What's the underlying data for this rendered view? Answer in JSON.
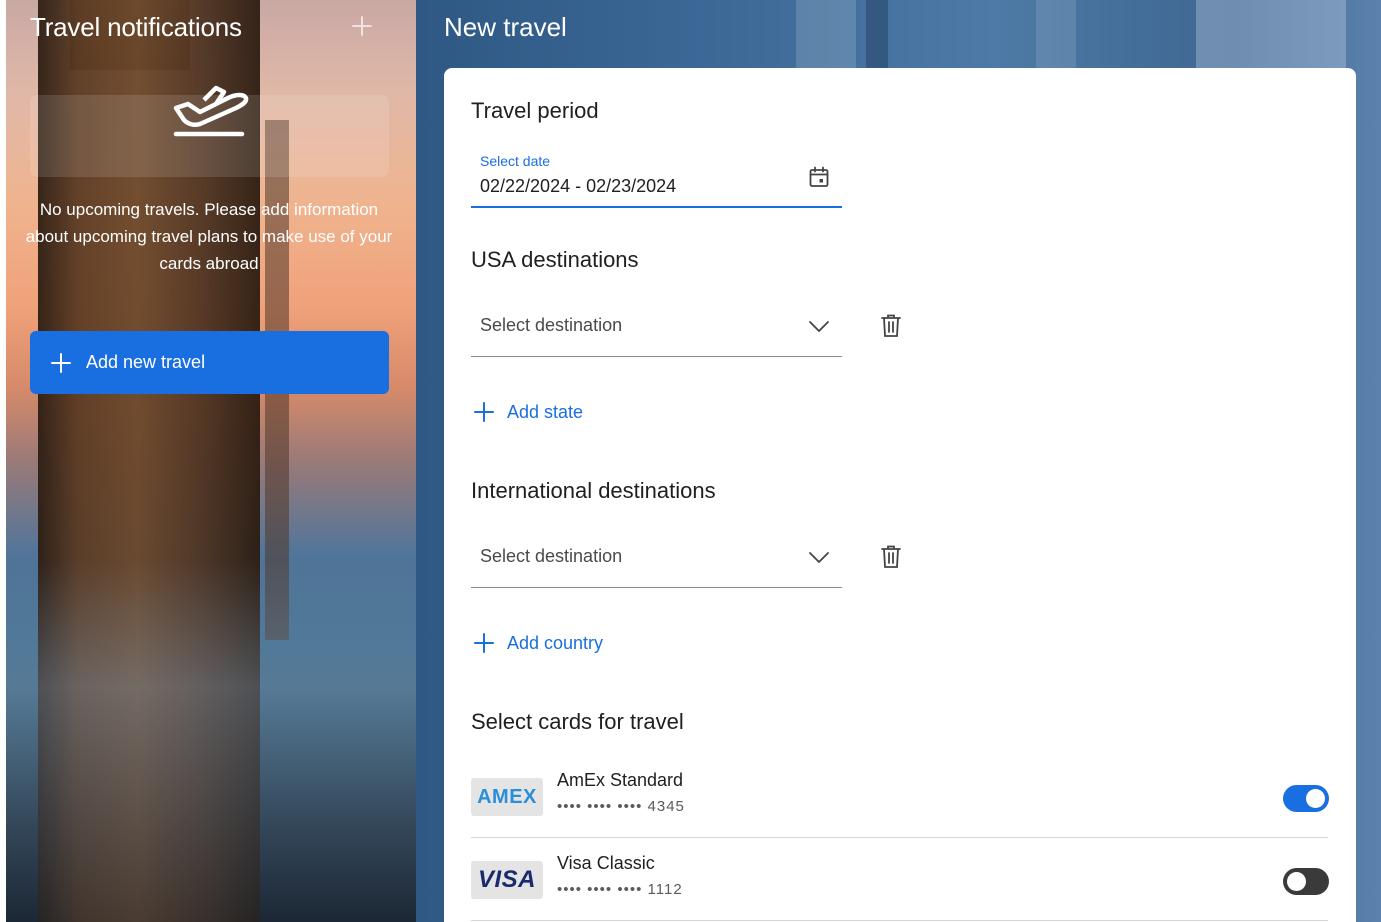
{
  "left": {
    "title": "Travel notifications",
    "empty_message": "No upcoming travels. Please add information about upcoming travel plans to make use of your cards abroad",
    "add_button_label": "Add new travel"
  },
  "right": {
    "title": "New travel",
    "travel_period": {
      "heading": "Travel period",
      "label": "Select date",
      "value": "02/22/2024 - 02/23/2024"
    },
    "usa": {
      "heading": "USA destinations",
      "placeholder": "Select destination",
      "add_label": "Add state"
    },
    "international": {
      "heading": "International destinations",
      "placeholder": "Select destination",
      "add_label": "Add country"
    },
    "cards": {
      "heading": "Select cards for travel",
      "items": [
        {
          "logo": "AMEX",
          "name": "AmEx Standard",
          "masked": "•••• •••• ••••",
          "last4": "4345",
          "enabled": true
        },
        {
          "logo": "VISA",
          "name": "Visa Classic",
          "masked": "•••• •••• ••••",
          "last4": "1112",
          "enabled": false
        }
      ]
    }
  },
  "colors": {
    "accent": "#1a6fe0",
    "toggle_off": "#3a3a3a",
    "text": "#1f1f1f"
  },
  "icons": [
    "plus-icon",
    "airplane-takeoff-icon",
    "calendar-icon",
    "chevron-down-icon",
    "trash-icon"
  ]
}
